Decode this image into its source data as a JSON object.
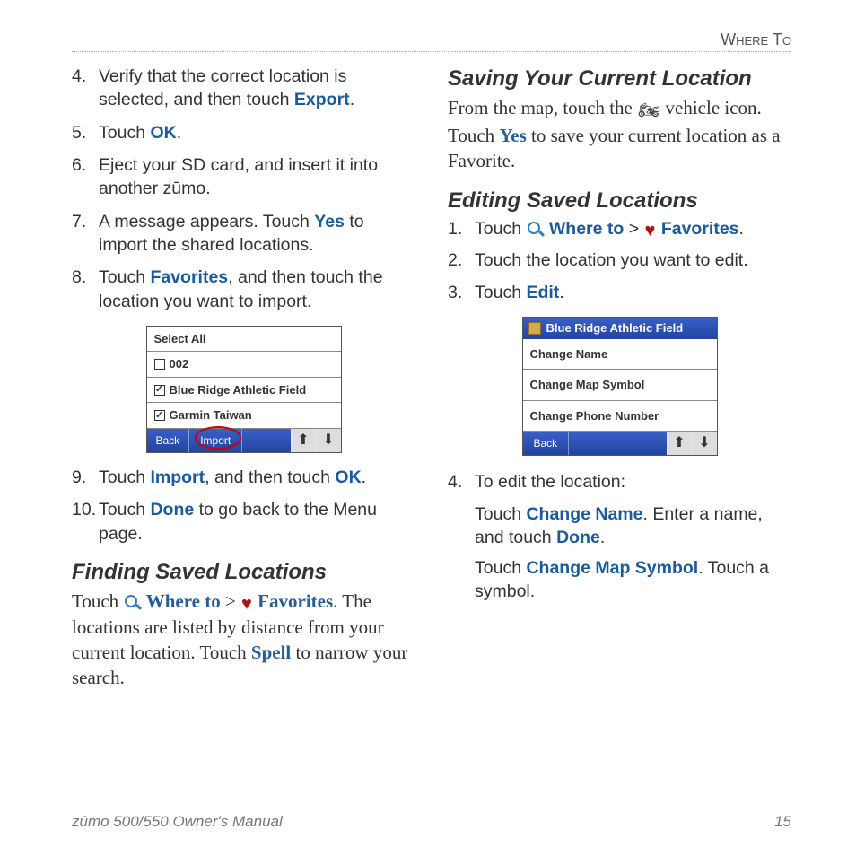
{
  "header": {
    "section": "Where To"
  },
  "left": {
    "step4": {
      "pre": "Verify that the correct location is selected, and then touch ",
      "action": "Export",
      "post": "."
    },
    "step5": {
      "pre": "Touch ",
      "action": "OK",
      "post": "."
    },
    "step6": "Eject your SD card, and insert it into another zūmo.",
    "step7": {
      "pre": "A message appears. Touch ",
      "action": "Yes",
      "post": " to import the shared locations."
    },
    "step8": {
      "pre": "Touch ",
      "action": "Favorites",
      "post": ", and then touch the location you want to import."
    },
    "device1": {
      "select_all": "Select All",
      "item1": "002",
      "item1_checked": false,
      "item2": "Blue Ridge Athletic Field",
      "item2_checked": true,
      "item3": "Garmin Taiwan",
      "item3_checked": true,
      "back": "Back",
      "import": "Import"
    },
    "step9": {
      "pre": "Touch ",
      "a1": "Import",
      "mid": ", and then touch ",
      "a2": "OK",
      "post": "."
    },
    "step10": {
      "pre": "Touch ",
      "a1": "Done",
      "post": " to go back to the Menu page."
    },
    "heading_find": "Finding Saved Locations",
    "find": {
      "p1_a": "Touch ",
      "where_to": "Where to",
      "sep": " > ",
      "favorites": "Favorites",
      "p1_b": ". The locations are listed by distance from your current location. Touch ",
      "spell": "Spell",
      "p1_c": " to narrow your search."
    }
  },
  "right": {
    "heading_saving": "Saving Your Current Location",
    "saving": {
      "p1": "From the map, touch the ",
      "p2": " vehicle icon. Touch ",
      "yes": "Yes",
      "p3": " to save your current location as a Favorite."
    },
    "heading_editing": "Editing Saved Locations",
    "edit_steps": {
      "s1": {
        "pre": "Touch ",
        "where_to": "Where to",
        "sep": " > ",
        "favorites": "Favorites",
        "post": "."
      },
      "s2": "Touch the location you want to edit.",
      "s3": {
        "pre": "Touch ",
        "action": "Edit",
        "post": "."
      }
    },
    "device2": {
      "title": "Blue Ridge Athletic Field",
      "change_name": "Change Name",
      "change_symbol": "Change Map Symbol",
      "change_phone": "Change Phone Number",
      "back": "Back"
    },
    "s4_label": "To edit the location:",
    "s4a": {
      "pre": "Touch ",
      "a1": "Change Name",
      "mid": ". Enter a name, and touch ",
      "a2": "Done",
      "post": "."
    },
    "s4b": {
      "pre": "Touch ",
      "a1": "Change Map Symbol",
      "post": ". Touch a symbol."
    }
  },
  "footer": {
    "title": "zūmo 500/550 Owner's Manual",
    "page": "15"
  }
}
